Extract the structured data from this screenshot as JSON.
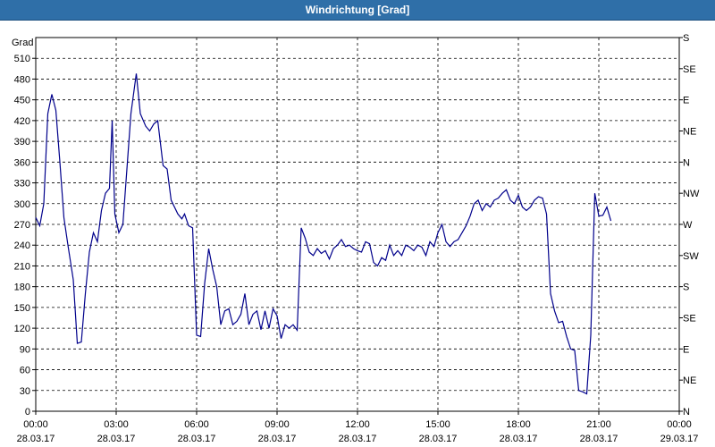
{
  "window": {
    "title": "Windrichtung [Grad]"
  },
  "chart_data": {
    "type": "line",
    "title": "Windrichtung [Grad]",
    "ylabel": "Grad",
    "ylim": [
      0,
      540
    ],
    "yticks": [
      0,
      30,
      60,
      90,
      120,
      150,
      180,
      210,
      240,
      270,
      300,
      330,
      360,
      390,
      420,
      450,
      480,
      510
    ],
    "y2_ticks": [
      {
        "value": 0,
        "label": "N"
      },
      {
        "value": 45,
        "label": "NE"
      },
      {
        "value": 90,
        "label": "E"
      },
      {
        "value": 135,
        "label": "SE"
      },
      {
        "value": 180,
        "label": "S"
      },
      {
        "value": 225,
        "label": "SW"
      },
      {
        "value": 270,
        "label": "W"
      },
      {
        "value": 315,
        "label": "NW"
      },
      {
        "value": 360,
        "label": "N"
      },
      {
        "value": 405,
        "label": "NE"
      },
      {
        "value": 450,
        "label": "E"
      },
      {
        "value": 495,
        "label": "SE"
      },
      {
        "value": 540,
        "label": "S"
      }
    ],
    "xlim_hours": [
      0,
      24
    ],
    "xticks": [
      {
        "h": 0,
        "time": "00:00",
        "date": "28.03.17"
      },
      {
        "h": 3,
        "time": "03:00",
        "date": "28.03.17"
      },
      {
        "h": 6,
        "time": "06:00",
        "date": "28.03.17"
      },
      {
        "h": 9,
        "time": "09:00",
        "date": "28.03.17"
      },
      {
        "h": 12,
        "time": "12:00",
        "date": "28.03.17"
      },
      {
        "h": 15,
        "time": "15:00",
        "date": "28.03.17"
      },
      {
        "h": 18,
        "time": "18:00",
        "date": "28.03.17"
      },
      {
        "h": 21,
        "time": "21:00",
        "date": "28.03.17"
      },
      {
        "h": 24,
        "time": "00:00",
        "date": "29.03.17"
      }
    ],
    "grid": true,
    "line_color": "#00008b",
    "series": [
      {
        "points": [
          [
            0.0,
            280
          ],
          [
            0.15,
            268
          ],
          [
            0.3,
            300
          ],
          [
            0.45,
            430
          ],
          [
            0.6,
            458
          ],
          [
            0.75,
            435
          ],
          [
            0.9,
            360
          ],
          [
            1.05,
            280
          ],
          [
            1.2,
            240
          ],
          [
            1.4,
            190
          ],
          [
            1.55,
            98
          ],
          [
            1.7,
            100
          ],
          [
            1.85,
            170
          ],
          [
            2.0,
            230
          ],
          [
            2.15,
            258
          ],
          [
            2.3,
            245
          ],
          [
            2.45,
            290
          ],
          [
            2.6,
            315
          ],
          [
            2.75,
            322
          ],
          [
            2.85,
            420
          ],
          [
            2.95,
            285
          ],
          [
            3.1,
            258
          ],
          [
            3.25,
            270
          ],
          [
            3.4,
            350
          ],
          [
            3.55,
            430
          ],
          [
            3.75,
            488
          ],
          [
            3.9,
            430
          ],
          [
            4.1,
            412
          ],
          [
            4.25,
            405
          ],
          [
            4.4,
            415
          ],
          [
            4.55,
            420
          ],
          [
            4.75,
            355
          ],
          [
            4.9,
            350
          ],
          [
            5.05,
            305
          ],
          [
            5.3,
            285
          ],
          [
            5.45,
            278
          ],
          [
            5.55,
            285
          ],
          [
            5.7,
            268
          ],
          [
            5.85,
            265
          ],
          [
            6.0,
            110
          ],
          [
            6.15,
            108
          ],
          [
            6.3,
            185
          ],
          [
            6.45,
            235
          ],
          [
            6.6,
            205
          ],
          [
            6.75,
            180
          ],
          [
            6.9,
            125
          ],
          [
            7.05,
            145
          ],
          [
            7.2,
            148
          ],
          [
            7.35,
            125
          ],
          [
            7.5,
            130
          ],
          [
            7.65,
            140
          ],
          [
            7.8,
            170
          ],
          [
            7.95,
            125
          ],
          [
            8.1,
            140
          ],
          [
            8.25,
            145
          ],
          [
            8.4,
            118
          ],
          [
            8.55,
            145
          ],
          [
            8.7,
            120
          ],
          [
            8.85,
            148
          ],
          [
            9.0,
            138
          ],
          [
            9.15,
            105
          ],
          [
            9.3,
            125
          ],
          [
            9.45,
            120
          ],
          [
            9.6,
            125
          ],
          [
            9.75,
            117
          ],
          [
            9.9,
            265
          ],
          [
            10.05,
            250
          ],
          [
            10.2,
            230
          ],
          [
            10.35,
            225
          ],
          [
            10.5,
            235
          ],
          [
            10.65,
            228
          ],
          [
            10.8,
            232
          ],
          [
            10.95,
            220
          ],
          [
            11.1,
            235
          ],
          [
            11.25,
            240
          ],
          [
            11.4,
            248
          ],
          [
            11.55,
            238
          ],
          [
            11.7,
            240
          ],
          [
            11.85,
            235
          ],
          [
            12.0,
            232
          ],
          [
            12.15,
            230
          ],
          [
            12.3,
            245
          ],
          [
            12.45,
            242
          ],
          [
            12.6,
            215
          ],
          [
            12.75,
            210
          ],
          [
            12.9,
            222
          ],
          [
            13.05,
            218
          ],
          [
            13.2,
            240
          ],
          [
            13.35,
            225
          ],
          [
            13.5,
            232
          ],
          [
            13.65,
            225
          ],
          [
            13.8,
            240
          ],
          [
            13.95,
            237
          ],
          [
            14.1,
            232
          ],
          [
            14.25,
            240
          ],
          [
            14.4,
            237
          ],
          [
            14.55,
            225
          ],
          [
            14.7,
            245
          ],
          [
            14.85,
            238
          ],
          [
            15.0,
            258
          ],
          [
            15.15,
            270
          ],
          [
            15.3,
            245
          ],
          [
            15.45,
            238
          ],
          [
            15.6,
            245
          ],
          [
            15.75,
            248
          ],
          [
            15.9,
            258
          ],
          [
            16.05,
            268
          ],
          [
            16.2,
            282
          ],
          [
            16.35,
            300
          ],
          [
            16.5,
            305
          ],
          [
            16.65,
            290
          ],
          [
            16.8,
            300
          ],
          [
            16.95,
            295
          ],
          [
            17.1,
            305
          ],
          [
            17.25,
            308
          ],
          [
            17.4,
            315
          ],
          [
            17.55,
            320
          ],
          [
            17.7,
            305
          ],
          [
            17.85,
            300
          ],
          [
            18.0,
            312
          ],
          [
            18.15,
            295
          ],
          [
            18.3,
            290
          ],
          [
            18.45,
            295
          ],
          [
            18.6,
            305
          ],
          [
            18.75,
            310
          ],
          [
            18.9,
            308
          ],
          [
            19.05,
            285
          ],
          [
            19.2,
            170
          ],
          [
            19.35,
            145
          ],
          [
            19.5,
            128
          ],
          [
            19.65,
            130
          ],
          [
            19.8,
            108
          ],
          [
            19.95,
            90
          ],
          [
            20.1,
            88
          ],
          [
            20.25,
            30
          ],
          [
            20.4,
            28
          ],
          [
            20.55,
            25
          ],
          [
            20.7,
            110
          ],
          [
            20.85,
            315
          ],
          [
            21.0,
            282
          ],
          [
            21.15,
            283
          ],
          [
            21.3,
            295
          ],
          [
            21.45,
            275
          ]
        ]
      }
    ]
  }
}
